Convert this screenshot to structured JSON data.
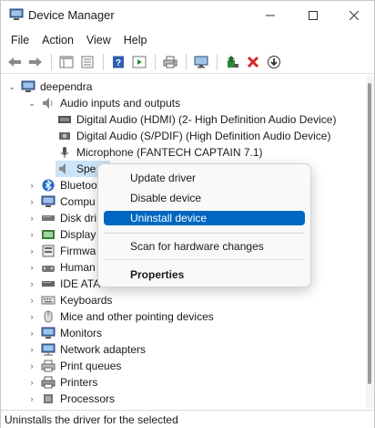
{
  "window": {
    "title": "Device Manager",
    "controls": {
      "minimize": "—",
      "maximize": "☐",
      "close": "✕"
    }
  },
  "menubar": [
    "File",
    "Action",
    "View",
    "Help"
  ],
  "toolbar": {
    "buttons": [
      "back-arrow-icon",
      "forward-arrow-icon",
      "properties-pane-icon",
      "device-list-icon",
      "help-icon",
      "run-icon",
      "print-icon",
      "monitor-scan-icon",
      "update-driver-icon",
      "uninstall-x-icon",
      "download-icon"
    ]
  },
  "tree": {
    "root": "deependra",
    "audio": {
      "label": "Audio inputs and outputs",
      "children": [
        "Digital Audio (HDMI) (2- High Definition Audio Device)",
        "Digital Audio (S/PDIF) (High Definition Audio Device)",
        "Microphone (FANTECH CAPTAIN 7.1)",
        "Spe"
      ]
    },
    "categories": [
      "Bluetooth",
      "Compu",
      "Disk dri",
      "Display",
      "Firmwa",
      "Human",
      "IDE ATA",
      "Keyboards",
      "Mice and other pointing devices",
      "Monitors",
      "Network adapters",
      "Print queues",
      "Printers",
      "Processors"
    ]
  },
  "context_menu": {
    "items": [
      {
        "label": "Update driver"
      },
      {
        "label": "Disable device"
      },
      {
        "label": "Uninstall device"
      },
      {
        "label": "Scan for hardware changes"
      },
      {
        "label": "Properties"
      }
    ],
    "highlighted": "Uninstall device"
  },
  "statusbar": {
    "text": "Uninstalls the driver for the selected"
  },
  "colors": {
    "highlight": "#0067c0",
    "selection": "#cce4f7",
    "uninstall_red": "#d42a2a",
    "update_green": "#2e8b3a"
  }
}
